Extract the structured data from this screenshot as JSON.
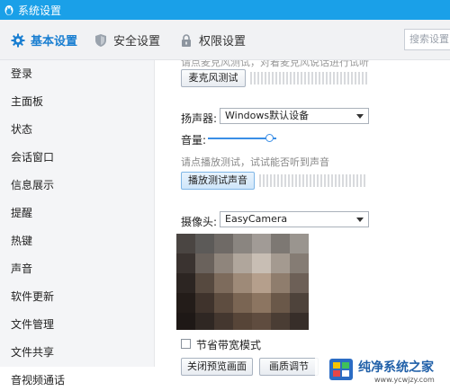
{
  "window": {
    "title": "系统设置"
  },
  "tabs": [
    {
      "label": "基本设置",
      "icon": "gear-icon",
      "active": true
    },
    {
      "label": "安全设置",
      "icon": "shield-icon",
      "active": false
    },
    {
      "label": "权限设置",
      "icon": "lock-icon",
      "active": false
    }
  ],
  "search": {
    "placeholder": "搜索设置"
  },
  "sidebar": {
    "items": [
      {
        "label": "登录"
      },
      {
        "label": "主面板"
      },
      {
        "label": "状态"
      },
      {
        "label": "会话窗口"
      },
      {
        "label": "信息展示"
      },
      {
        "label": "提醒"
      },
      {
        "label": "热键"
      },
      {
        "label": "声音"
      },
      {
        "label": "软件更新"
      },
      {
        "label": "文件管理"
      },
      {
        "label": "文件共享"
      },
      {
        "label": "音视频通话",
        "active": true
      }
    ]
  },
  "audio": {
    "mic_hint": "请点麦克风测试，对着麦克风说话进行试听",
    "mic_test_button": "麦克风测试",
    "speaker_label": "扬声器:",
    "speaker_value": "Windows默认设备",
    "volume_label": "音量:",
    "volume_level": 0.85,
    "play_hint": "请点播放测试，试试能否听到声音",
    "play_test_button": "播放测试声音"
  },
  "video": {
    "camera_label": "摄像头:",
    "camera_value": "EasyCamera",
    "bandwidth_checkbox_label": "节省带宽模式",
    "bandwidth_checked": false,
    "close_preview_button": "关闭预览画面",
    "quality_button": "画质调节"
  },
  "watermark": {
    "title": "纯净系统之家",
    "url": "www.ycwjzy.com"
  },
  "colors": {
    "titlebar": "#1aa0e8",
    "accent": "#1a7fd1",
    "slider": "#3a8ee6"
  }
}
